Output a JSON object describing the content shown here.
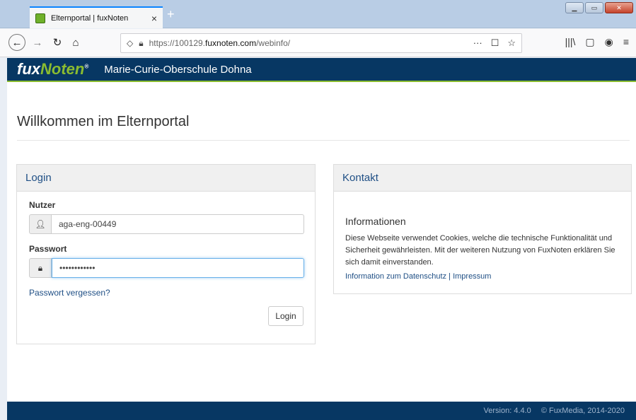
{
  "browser": {
    "tab_title": "Elternportal | fuxNoten",
    "tab_close": "×",
    "new_tab": "+",
    "url_prefix": "https://100129.",
    "url_domain": "fuxnoten.com",
    "url_path": "/webinfo/",
    "url_actions": [
      "···",
      "☐",
      "☆"
    ],
    "toolbar_right": [
      "|||\\",
      "▢",
      "◉",
      "≡"
    ]
  },
  "site": {
    "logo_fux": "fux",
    "logo_noten": "Noten",
    "logo_reg": "®",
    "school_name": "Marie-Curie-Oberschule Dohna"
  },
  "page": {
    "welcome": "Willkommen im Elternportal"
  },
  "login": {
    "heading": "Login",
    "user_label": "Nutzer",
    "user_value": "aga-eng-00449",
    "password_label": "Passwort",
    "password_value": "••••••••••••",
    "forgot_link": "Passwort vergessen?",
    "submit": "Login"
  },
  "kontakt": {
    "heading": "Kontakt",
    "info_title": "Informationen",
    "info_text": "Diese Webseite verwendet Cookies, welche die technische Funktionalität und Sicherheit gewährleisten. Mit der weiteren Nutzung von FuxNoten erklären Sie sich damit einverstanden.",
    "link_privacy": "Information zum Datenschutz",
    "link_sep": " | ",
    "link_impressum": "Impressum"
  },
  "footer": {
    "version": "Version: 4.4.0",
    "copyright": "© FuxMedia, 2014-2020"
  },
  "colors": {
    "header_bg": "#073763",
    "accent_green": "#8bbc30",
    "link": "#1f4f85"
  }
}
